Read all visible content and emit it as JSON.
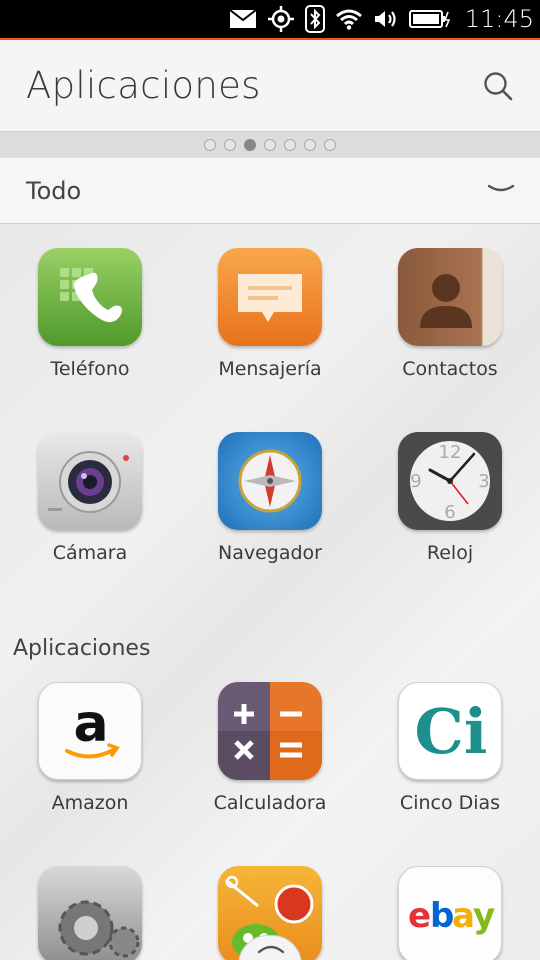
{
  "status": {
    "time": "11:45"
  },
  "header": {
    "title": "Aplicaciones"
  },
  "pager": {
    "count": 7,
    "active": 2
  },
  "filter": {
    "label": "Todo"
  },
  "favorites": [
    {
      "label": "Teléfono",
      "icon": "phone-icon"
    },
    {
      "label": "Mensajería",
      "icon": "messaging-icon"
    },
    {
      "label": "Contactos",
      "icon": "contacts-icon"
    },
    {
      "label": "Cámara",
      "icon": "camera-icon"
    },
    {
      "label": "Navegador",
      "icon": "browser-icon"
    },
    {
      "label": "Reloj",
      "icon": "clock-icon"
    }
  ],
  "apps_section": {
    "title": "Aplicaciones",
    "apps": [
      {
        "label": "Amazon",
        "icon": "amazon-icon"
      },
      {
        "label": "Calculadora",
        "icon": "calculator-icon"
      },
      {
        "label": "Cinco Dias",
        "icon": "cinco-dias-icon"
      },
      {
        "label": "",
        "icon": "settings-icon"
      },
      {
        "label": "",
        "icon": "cut-the-rope-icon"
      },
      {
        "label": "",
        "icon": "ebay-icon"
      }
    ]
  },
  "icon_text": {
    "amazon": "a",
    "cinco_dias": "Ci",
    "ebay": [
      "e",
      "b",
      "a",
      "y"
    ],
    "clock": [
      "12",
      "3",
      "6",
      "9"
    ]
  },
  "colors": {
    "accent": "#e95420"
  }
}
